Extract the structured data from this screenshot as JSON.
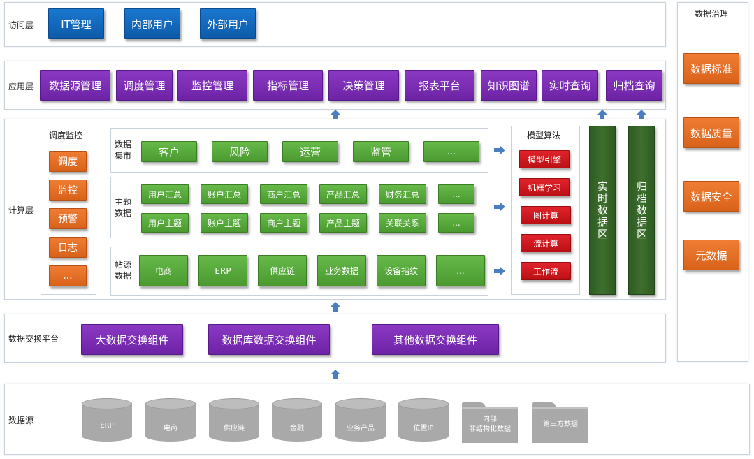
{
  "access_layer": {
    "label": "访问层",
    "items": [
      "IT管理",
      "内部用户",
      "外部用户"
    ]
  },
  "app_layer": {
    "label": "应用层",
    "items": [
      "数据源管理",
      "调度管理",
      "监控管理",
      "指标管理",
      "决策管理",
      "报表平台",
      "知识图谱",
      "实时查询",
      "归档查询"
    ]
  },
  "compute_layer": {
    "label": "计算层",
    "scheduling": {
      "title": "调度监控",
      "items": [
        "调度",
        "监控",
        "预警",
        "日志",
        "..."
      ]
    },
    "data_mart": {
      "label": "数据\n集市",
      "items": [
        "客户",
        "风险",
        "运营",
        "监管",
        "..."
      ]
    },
    "subject_data": {
      "label": "主题\n数据",
      "row1": [
        "用户汇总",
        "账户汇总",
        "商户汇总",
        "产品汇总",
        "财务汇总",
        "..."
      ],
      "row2": [
        "用户主题",
        "账户主题",
        "商户主题",
        "产品主题",
        "关联关系",
        "..."
      ]
    },
    "source_data": {
      "label": "帖源\n数据",
      "items": [
        "电商",
        "ERP",
        "供应链",
        "业务数据",
        "设备指纹",
        "..."
      ]
    },
    "model_algo": {
      "title": "模型算法",
      "items": [
        "模型引擎",
        "机器学习",
        "图计算",
        "流计算",
        "工作流"
      ]
    },
    "realtime_zone": "实时数据区",
    "archive_zone": "归档数据区"
  },
  "exchange_layer": {
    "label": "数据交换平台",
    "items": [
      "大数据交换组件",
      "数据库数据交换组件",
      "其他数据交换组件"
    ]
  },
  "source_layer": {
    "label": "数据源",
    "databases": [
      "ERP",
      "电商",
      "供应链",
      "金融",
      "业务产品",
      "位置IP"
    ],
    "folders": [
      "内部\n非结构化数据",
      "第三方数据"
    ]
  },
  "governance": {
    "title": "数据治理",
    "items": [
      "数据标准",
      "数据质量",
      "数据安全",
      "元数据"
    ]
  },
  "colors": {
    "blue": "#1267bd",
    "purple": "#7a2db3",
    "green": "#57a83b",
    "orange": "#e96f24",
    "red": "#c8161d",
    "dark_green": "#355f27",
    "arrow": "#4a7ec0"
  }
}
